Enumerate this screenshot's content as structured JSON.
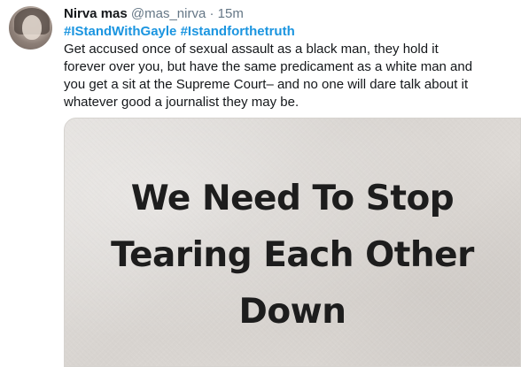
{
  "tweet": {
    "author_name": "Nirva mas",
    "author_handle": "@mas_nirva",
    "separator": "·",
    "timestamp": "15m",
    "hashtags": [
      "#IStandWithGayle",
      "#Istandforthetruth"
    ],
    "text_lines": [
      "Get accused once of sexual assault as a black man, they hold it",
      "forever over you, but have the same predicament as a white man and",
      "you get a sit at the Supreme Court–  and no one will dare talk about it",
      "whatever good a journalist they may be."
    ],
    "image_text_lines": [
      "We Need To Stop",
      "Tearing Each Other",
      "Down"
    ]
  },
  "colors": {
    "link": "#1b95e0",
    "text": "#14171a",
    "muted": "#657786"
  }
}
